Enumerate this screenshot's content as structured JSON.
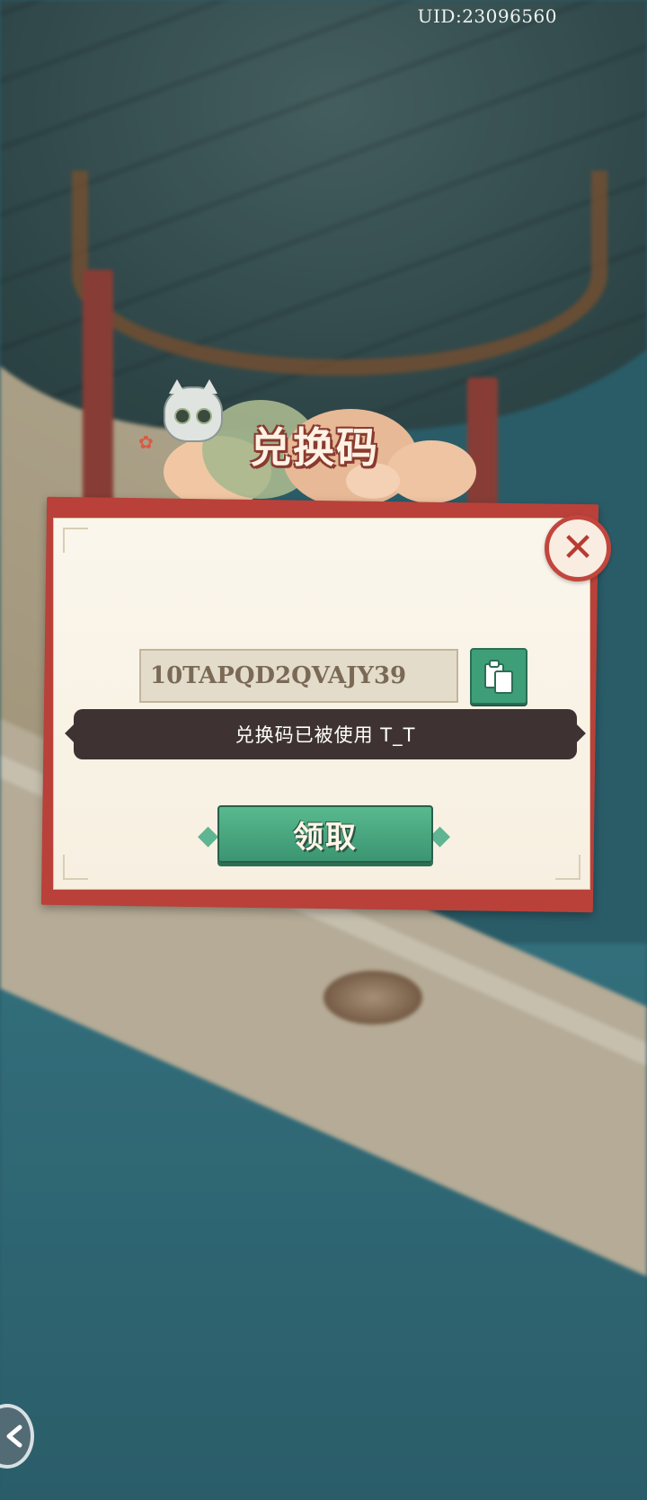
{
  "header": {
    "uid_text": "UID:23096560"
  },
  "dialog": {
    "title": "兑换码",
    "close_label": "✕",
    "code_input": {
      "value": "10TAPQD2QVAJY39",
      "placeholder": ""
    },
    "status_message": "兑换码已被使用 T_T",
    "claim_button_label": "领取"
  },
  "colors": {
    "accent_green": "#3e9e78",
    "frame_red": "#b9413a",
    "paper": "#fbf6ec",
    "notice_bg": "#3e3332"
  },
  "icons": [
    "close-icon",
    "paste-icon",
    "back-icon",
    "cat-icon"
  ]
}
